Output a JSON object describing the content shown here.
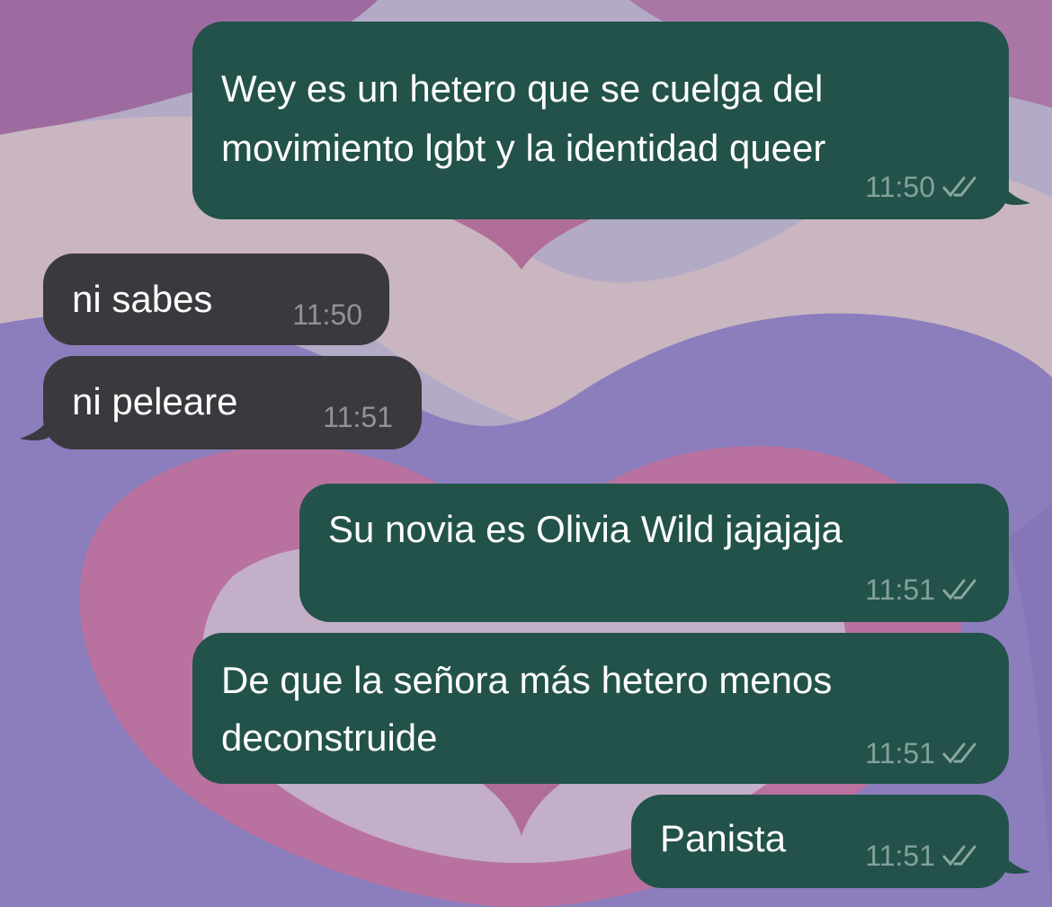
{
  "colors": {
    "outgoing_bubble": "#22524a",
    "incoming_bubble": "#3a393d",
    "message_text": "#ffffff",
    "timestamp": "#9fb5ae"
  },
  "messages": [
    {
      "direction": "outgoing",
      "lines": [
        "Wey es un hetero que se cuelga del",
        "movimiento lgbt y la identidad queer"
      ],
      "time": "11:50",
      "status": "read-double-check-icon"
    },
    {
      "direction": "incoming",
      "lines": [
        "ni sabes"
      ],
      "time": "11:50"
    },
    {
      "direction": "incoming",
      "lines": [
        "ni peleare"
      ],
      "time": "11:51"
    },
    {
      "direction": "outgoing",
      "lines": [
        "Su novia es Olivia Wild jajajaja"
      ],
      "time": "11:51",
      "status": "read-double-check-icon"
    },
    {
      "direction": "outgoing",
      "lines": [
        "De que la señora más hetero menos",
        "deconstruide"
      ],
      "time": "11:51",
      "status": "read-double-check-icon"
    },
    {
      "direction": "outgoing",
      "lines": [
        "Panista"
      ],
      "time": "11:51",
      "status": "read-double-check-icon"
    }
  ]
}
